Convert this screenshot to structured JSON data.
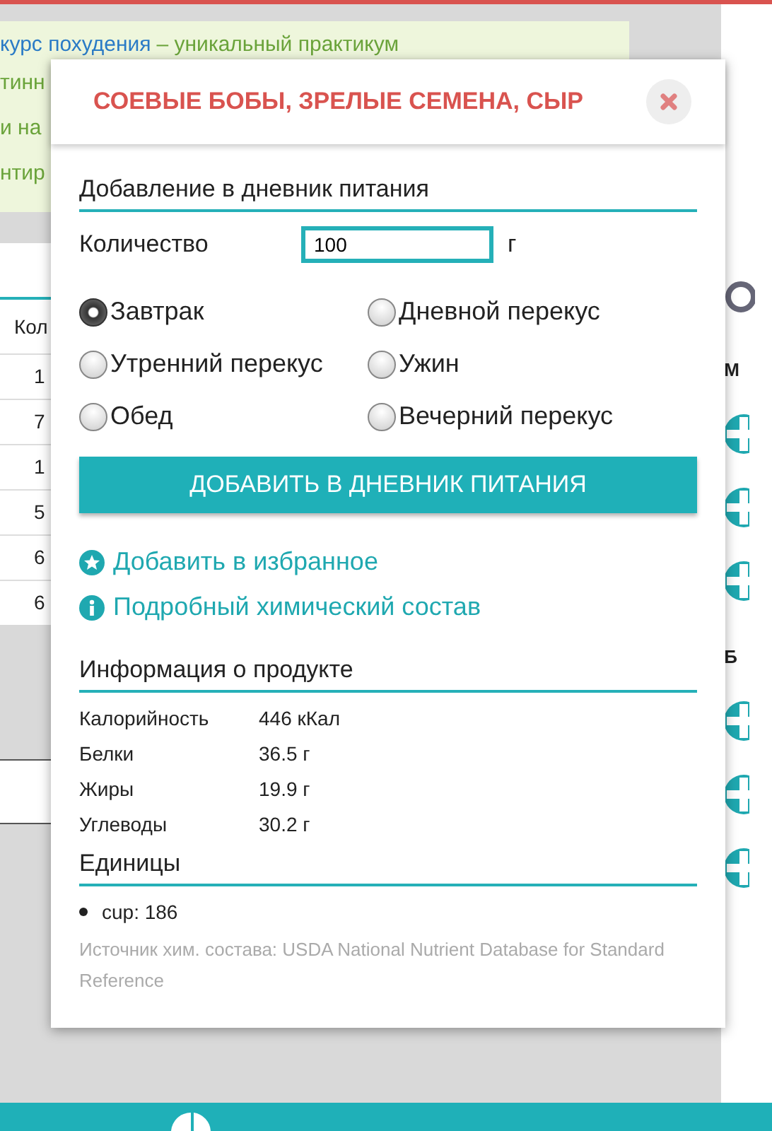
{
  "background": {
    "notice": {
      "link": "курс похудения",
      "text": "– уникальный практикум",
      "lines": [
        "тинн",
        "и на",
        "нтир"
      ]
    },
    "table": {
      "header": "Кол",
      "cells": [
        "1",
        "7",
        "1",
        "5",
        "6",
        "6"
      ]
    },
    "side": {
      "labels": [
        "М",
        "Б"
      ]
    }
  },
  "dialog": {
    "title": "СОЕВЫЕ БОБЫ, ЗРЕЛЫЕ СЕМЕНА, СЫР",
    "add_section": {
      "title": "Добавление в дневник питания",
      "quantity_label": "Количество",
      "quantity_value": "100",
      "unit": "г",
      "meals": [
        {
          "label": "Завтрак",
          "selected": true
        },
        {
          "label": "Дневной перекус",
          "selected": false
        },
        {
          "label": "Утренний перекус",
          "selected": false
        },
        {
          "label": "Ужин",
          "selected": false
        },
        {
          "label": "Обед",
          "selected": false
        },
        {
          "label": "Вечерний перекус",
          "selected": false
        }
      ],
      "button": "ДОБАВИТЬ В ДНЕВНИК ПИТАНИЯ"
    },
    "links": [
      {
        "kind": "star",
        "label": "Добавить в избранное"
      },
      {
        "kind": "info",
        "label": "Подробный химический состав"
      }
    ],
    "info": {
      "title": "Информация о продукте",
      "rows": [
        {
          "name": "Калорийность",
          "value": "446 кКал"
        },
        {
          "name": "Белки",
          "value": "36.5 г"
        },
        {
          "name": "Жиры",
          "value": "19.9 г"
        },
        {
          "name": "Углеводы",
          "value": "30.2 г"
        }
      ]
    },
    "units": {
      "title": "Единицы",
      "items": [
        "cup: 186"
      ]
    },
    "source": "Источник хим. состава: USDA National Nutrient Database for Standard Reference"
  }
}
